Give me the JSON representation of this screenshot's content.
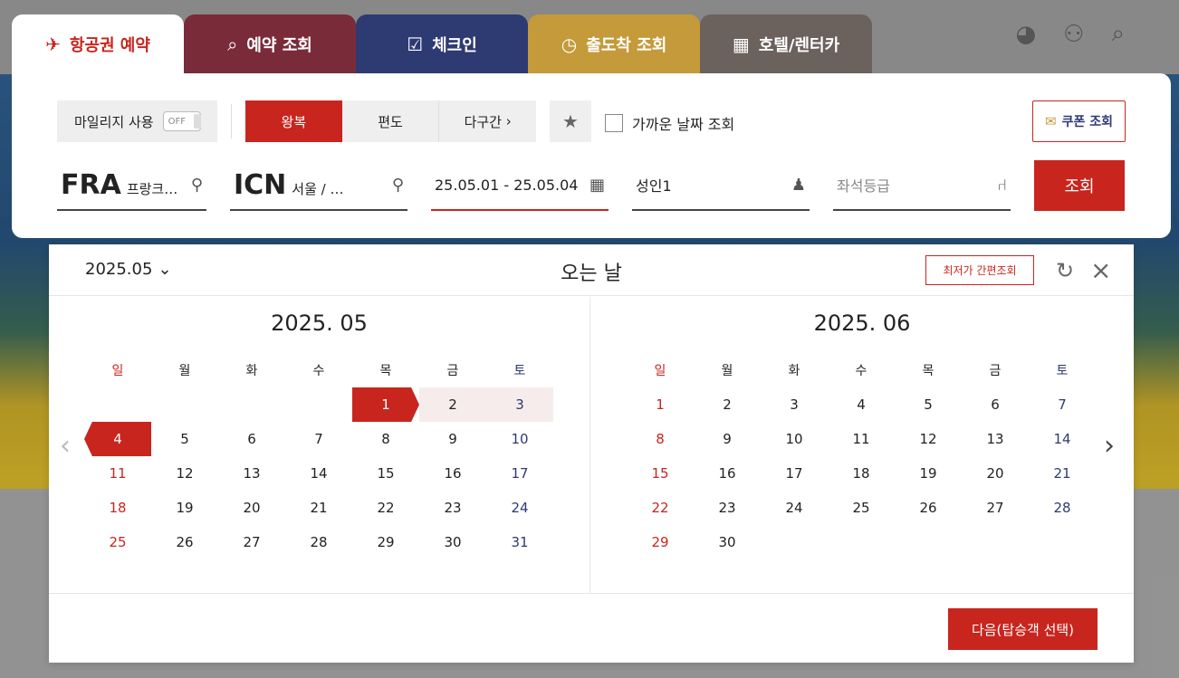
{
  "tabs": [
    {
      "label": "항공권 예약",
      "icon": "plane-ticket-icon"
    },
    {
      "label": "예약 조회",
      "icon": "search-icon"
    },
    {
      "label": "체크인",
      "icon": "ticket-check-icon"
    },
    {
      "label": "출도착 조회",
      "icon": "clock-icon"
    },
    {
      "label": "호텔/렌터카",
      "icon": "hotel-car-icon"
    }
  ],
  "options": {
    "mileage_label": "마일리지 사용",
    "mileage_toggle": "OFF",
    "trip_types": [
      "왕복",
      "편도",
      "다구간"
    ],
    "nearby_label": "가까운 날짜 조회",
    "coupon_label": "쿠폰 조회"
  },
  "search": {
    "from_code": "FRA",
    "from_city": "프랑크…",
    "to_code": "ICN",
    "to_city": "서울 / …",
    "dates": "25.05.01 - 25.05.04",
    "passengers": "성인1",
    "seat_placeholder": "좌석등급",
    "search_button": "조회"
  },
  "calendar": {
    "month_select": "2025.05",
    "title": "오는 날",
    "lowfare_button": "최저가 간편조회",
    "weekdays": [
      "일",
      "월",
      "화",
      "수",
      "목",
      "금",
      "토"
    ],
    "months": [
      {
        "title": "2025. 05",
        "weeks": [
          [
            "",
            "",
            "",
            "",
            "1",
            "2",
            "3"
          ],
          [
            "4",
            "5",
            "6",
            "7",
            "8",
            "9",
            "10"
          ],
          [
            "11",
            "12",
            "13",
            "14",
            "15",
            "16",
            "17"
          ],
          [
            "18",
            "19",
            "20",
            "21",
            "22",
            "23",
            "24"
          ],
          [
            "25",
            "26",
            "27",
            "28",
            "29",
            "30",
            "31"
          ]
        ]
      },
      {
        "title": "2025. 06",
        "weeks": [
          [
            "1",
            "2",
            "3",
            "4",
            "5",
            "6",
            "7"
          ],
          [
            "8",
            "9",
            "10",
            "11",
            "12",
            "13",
            "14"
          ],
          [
            "15",
            "16",
            "17",
            "18",
            "19",
            "20",
            "21"
          ],
          [
            "22",
            "23",
            "24",
            "25",
            "26",
            "27",
            "28"
          ],
          [
            "29",
            "30",
            "",
            "",
            "",
            "",
            ""
          ]
        ]
      }
    ],
    "selected_start": "2025-05-01",
    "selected_end": "2025-05-04",
    "next_button": "다음(탑승객 선택)"
  },
  "colors": {
    "accent": "#c8251e",
    "navy": "#2e3a72"
  }
}
